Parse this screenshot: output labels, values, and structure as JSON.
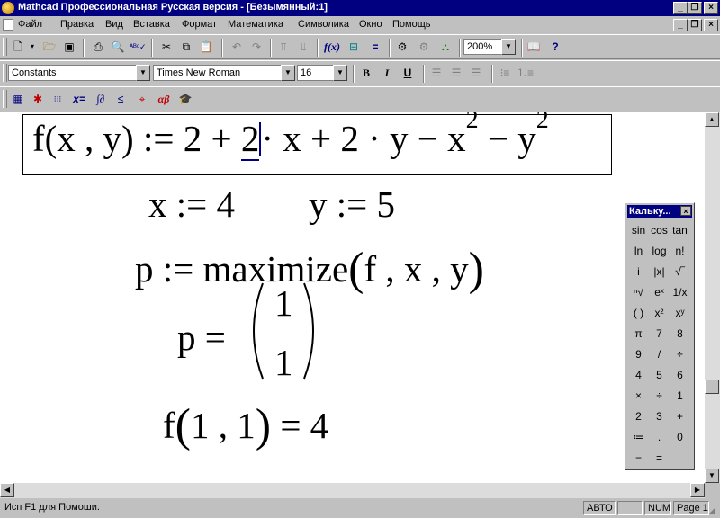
{
  "window": {
    "title": "Mathcad Профессиональная Русская версия - [Безымянный:1]"
  },
  "menu": [
    "Файл",
    "Правка",
    "Вид",
    "Вставка",
    "Формат",
    "Математика",
    "Символика",
    "Окно",
    "Помощь"
  ],
  "toolbar": {
    "zoom": "200%"
  },
  "format_bar": {
    "style": "Constants",
    "font": "Times New Roman",
    "size": "16",
    "bold": "B",
    "italic": "I",
    "underline": "U"
  },
  "math_bar": {
    "calc": "▦",
    "graph": "✱",
    "matrix": "⁝⁝⁝",
    "eval": "x=",
    "calculus": "∫∂",
    "boolean": "≤",
    "program": "⌖",
    "greek": "αβ",
    "symbolic": "🎓"
  },
  "worksheet": {
    "def": {
      "lhs": "f(x , y)",
      "assign": ":=",
      "t1": "2 + ",
      "t2": "2",
      "t3": "· x + 2 · y − x",
      "t4": " − y",
      "exp1": "2",
      "exp2": "2"
    },
    "x_assign": "x :=  4",
    "y_assign": "y :=  5",
    "maximize": {
      "lhs": "p :=  maximize",
      "args": "f , x , y"
    },
    "p_result": {
      "lhs": "p  =",
      "v1": "1",
      "v2": "1"
    },
    "f_eval": {
      "lhs": "f",
      "args": "1 , 1",
      "rhs": " =  4"
    }
  },
  "statusbar": {
    "help": "Исп F1 для Помоши.",
    "auto": "АВТО",
    "num": "NUM",
    "page": "Page 1"
  },
  "calculator": {
    "title": "Кальку...",
    "keys": [
      [
        "sin",
        "cos",
        "tan"
      ],
      [
        "ln",
        "log",
        "n!"
      ],
      [
        "i",
        "|x|",
        "√‾"
      ],
      [
        "ⁿ√",
        "eˣ",
        "1/x"
      ],
      [
        "( )",
        "x²",
        "xʸ"
      ],
      [
        "π",
        "7",
        "8"
      ],
      [
        "9",
        "/",
        "÷"
      ],
      [
        "4",
        "5",
        "6"
      ],
      [
        "×",
        "÷",
        "1"
      ],
      [
        "2",
        "3",
        "+"
      ],
      [
        "≔",
        ".",
        "0"
      ],
      [
        "−",
        "=",
        ""
      ]
    ]
  }
}
